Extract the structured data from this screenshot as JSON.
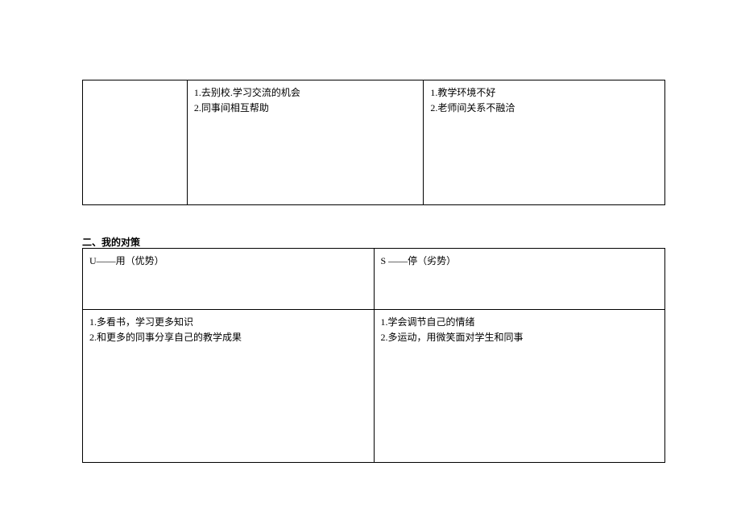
{
  "table1": {
    "col1": "",
    "col2_line1": "1.去别校.学习交流的机会",
    "col2_line2": "2.同事间相互帮助",
    "col3_line1": "1.教学环境不好",
    "col3_line2": "2.老师间关系不融洽"
  },
  "section2_title": "二、我的对策",
  "table2": {
    "header_left": "U——用（优势）",
    "header_right": "S ——停（劣势）",
    "body_left_line1": "1.多看书，学习更多知识",
    "body_left_line2": "2.和更多的同事分享自己的教学成果",
    "body_right_line1": "1.学会调节自己的情绪",
    "body_right_line2": "2.多运动，用微笑面对学生和同事"
  }
}
